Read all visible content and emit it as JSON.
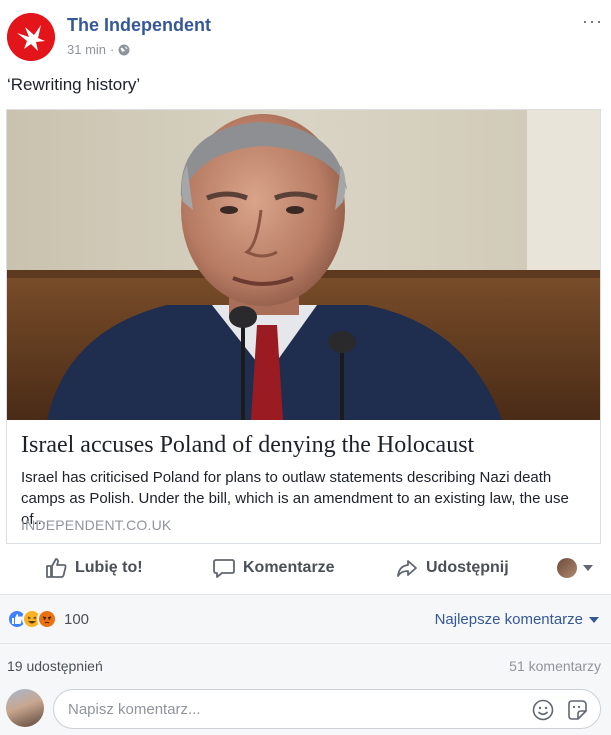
{
  "post": {
    "page_name": "The Independent",
    "time": "31 min",
    "separator": "·",
    "more_glyph": "···",
    "text": "‘Rewriting history’",
    "icons": {
      "avatar": "independent-eagle-logo",
      "privacy": "globe-icon",
      "more": "more-options-icon"
    },
    "colors": {
      "brand_red": "#e3151b",
      "link_blue": "#365899"
    }
  },
  "card": {
    "image": "netanyahu-speaking-at-microphone-photo",
    "title": "Israel accuses Poland of denying the Holocaust",
    "description": "Israel has criticised Poland for plans to outlaw statements describing Nazi death camps as Polish. Under the bill, which is an amendment to an existing law, the use of...",
    "domain": "INDEPENDENT.CO.UK"
  },
  "actions": {
    "like": "Lubię to!",
    "comment": "Komentarze",
    "share": "Udostępnij",
    "icons": {
      "like": "thumbs-up-icon",
      "comment": "speech-bubble-icon",
      "share": "share-arrow-icon"
    }
  },
  "stats": {
    "reactions": [
      "like",
      "haha",
      "angry"
    ],
    "reaction_count": "100",
    "sort_label": "Najlepsze komentarze",
    "shares": "19 udostępnień",
    "comments": "51 komentarzy"
  },
  "comment_box": {
    "placeholder": "Napisz komentarz...",
    "icons": {
      "emoji": "smiley-icon",
      "sticker": "sticker-icon"
    }
  }
}
